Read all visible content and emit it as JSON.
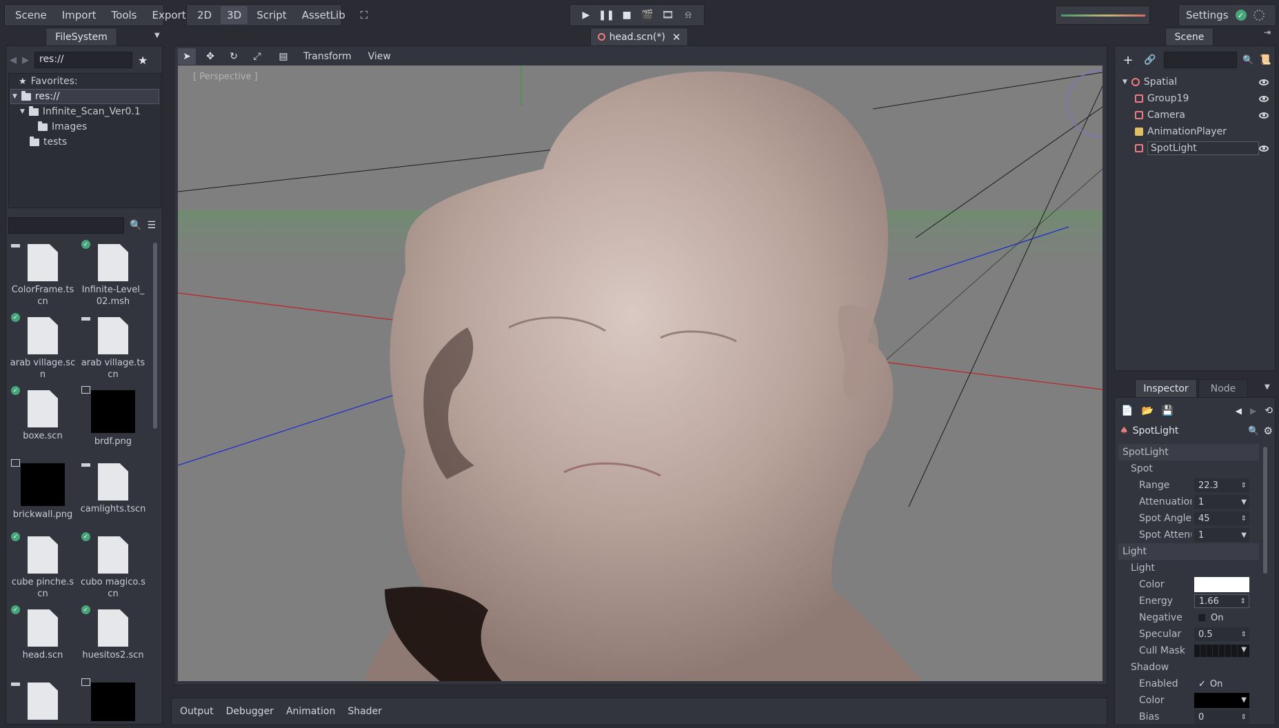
{
  "menus": {
    "main": [
      "Scene",
      "Import",
      "Tools",
      "Export"
    ],
    "workspaces": [
      "2D",
      "3D",
      "Script",
      "AssetLib"
    ],
    "active_workspace": "3D"
  },
  "settings": {
    "label": "Settings"
  },
  "filesystem": {
    "tab_label": "FileSystem",
    "path": "res://",
    "tree": {
      "favorites": "Favorites:",
      "root": "res://",
      "folder1": "Infinite_Scan_Ver0.1",
      "folder1_child": "Images",
      "folder2": "tests"
    },
    "files": [
      {
        "name": "ColorFrame.tscn",
        "icon": "scene-doc",
        "badge": "clapper"
      },
      {
        "name": "Infinite-Level_02.msh",
        "icon": "doc",
        "badge": "check"
      },
      {
        "name": "arab village.scn",
        "icon": "doc",
        "badge": "check"
      },
      {
        "name": "arab village.tscn",
        "icon": "doc",
        "badge": "clapper"
      },
      {
        "name": "boxe.scn",
        "icon": "doc",
        "badge": "check"
      },
      {
        "name": "brdf.png",
        "icon": "image",
        "badge": "image"
      },
      {
        "name": "brickwall.png",
        "icon": "image",
        "badge": "image"
      },
      {
        "name": "camlights.tscn",
        "icon": "doc",
        "badge": "clapper"
      },
      {
        "name": "cube pinche.scn",
        "icon": "doc",
        "badge": "check"
      },
      {
        "name": "cubo magico.scn",
        "icon": "doc",
        "badge": "check"
      },
      {
        "name": "head.scn",
        "icon": "doc",
        "badge": "check"
      },
      {
        "name": "huesitos2.scn",
        "icon": "doc",
        "badge": "check"
      },
      {
        "name": "",
        "icon": "doc",
        "badge": "clapper"
      },
      {
        "name": "",
        "icon": "image",
        "badge": "image"
      }
    ]
  },
  "editor": {
    "scene_tab": "head.scn(*)",
    "toolbar_menus": [
      "Transform",
      "View"
    ],
    "viewport_label": "[ Perspective ]"
  },
  "bottom_tabs": [
    "Output",
    "Debugger",
    "Animation",
    "Shader"
  ],
  "scene_dock": {
    "tab_label": "Scene",
    "nodes": [
      {
        "name": "Spatial",
        "icon": "spatial-icon",
        "color": "#f07d7d",
        "indent": 0,
        "visible": true
      },
      {
        "name": "Group19",
        "icon": "mesh-icon",
        "color": "#f07d7d",
        "indent": 1,
        "visible": true
      },
      {
        "name": "Camera",
        "icon": "camera-icon",
        "color": "#f07d7d",
        "indent": 1,
        "visible": true
      },
      {
        "name": "AnimationPlayer",
        "icon": "animation-player-icon",
        "color": "#e0c060",
        "indent": 1,
        "visible": false
      },
      {
        "name": "SpotLight",
        "icon": "spotlight-icon",
        "color": "#f07d7d",
        "indent": 1,
        "visible": true,
        "selected": true
      }
    ]
  },
  "inspector": {
    "tabs": [
      "Inspector",
      "Node"
    ],
    "node_name": "SpotLight",
    "sections": {
      "spotlight_header": "SpotLight",
      "spot_sub": "Spot",
      "range_label": "Range",
      "range_value": "22.3",
      "attenuation_label": "Attenuation",
      "attenuation_value": "1",
      "spot_angle_label": "Spot Angle",
      "spot_angle_value": "45",
      "spot_atten_label": "Spot Attenuatio",
      "spot_atten_value": "1",
      "light_header": "Light",
      "light_sub": "Light",
      "color_label": "Color",
      "color_value": "#ffffff",
      "energy_label": "Energy",
      "energy_value": "1.66",
      "negative_label": "Negative",
      "negative_value": "On",
      "specular_label": "Specular",
      "specular_value": "0.5",
      "cull_label": "Cull Mask",
      "shadow_sub": "Shadow",
      "enabled_label": "Enabled",
      "enabled_value": "On",
      "shadow_color_label": "Color",
      "shadow_color_value": "#000000",
      "bias_label": "Bias",
      "bias_value": "0"
    }
  }
}
